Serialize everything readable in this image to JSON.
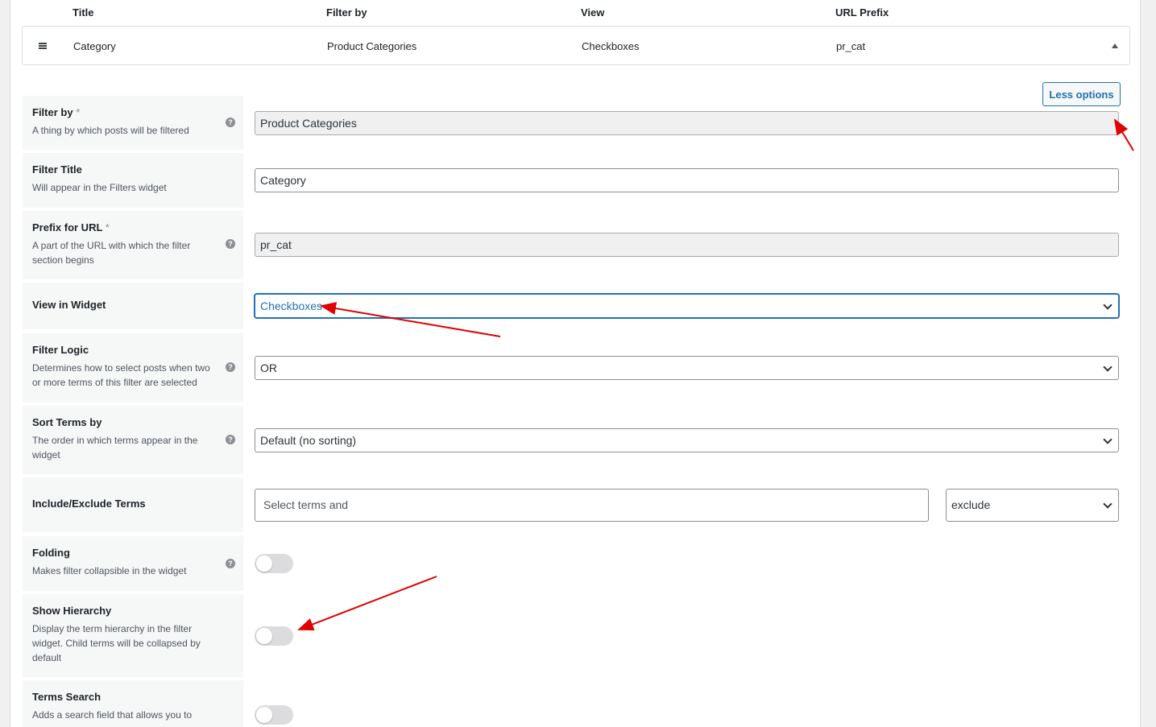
{
  "table": {
    "headers": [
      "Title",
      "Filter by",
      "View",
      "URL Prefix"
    ],
    "row": {
      "title": "Category",
      "filter_by": "Product Categories",
      "view": "Checkboxes",
      "url_prefix": "pr_cat"
    }
  },
  "less_options_label": "Less options",
  "settings": {
    "filter_by": {
      "label": "Filter by",
      "required_mark": "*",
      "desc": "A thing by which posts will be filtered",
      "value": "Product Categories"
    },
    "filter_title": {
      "label": "Filter Title",
      "desc": "Will appear in the Filters widget",
      "value": "Category"
    },
    "prefix": {
      "label": "Prefix for URL",
      "required_mark": "*",
      "desc": "A part of the URL with which the filter section begins",
      "value": "pr_cat"
    },
    "view_in_widget": {
      "label": "View in Widget",
      "value": "Checkboxes"
    },
    "filter_logic": {
      "label": "Filter Logic",
      "desc": "Determines how to select posts when two or more terms of this filter are selected",
      "value": "OR"
    },
    "sort_terms": {
      "label": "Sort Terms by",
      "desc": "The order in which terms appear in the widget",
      "value": "Default (no sorting)"
    },
    "include_exclude": {
      "label": "Include/Exclude Terms",
      "placeholder": "Select terms and",
      "mode": "exclude"
    },
    "folding": {
      "label": "Folding",
      "desc": "Makes filter collapsible in the widget",
      "enabled": false
    },
    "show_hierarchy": {
      "label": "Show Hierarchy",
      "desc": "Display the term hierarchy in the filter widget. Child terms will be collapsed by default",
      "enabled": false
    },
    "terms_search": {
      "label": "Terms Search",
      "desc": "Adds a search field that allows you to",
      "enabled": false
    }
  },
  "help_glyph": "?",
  "colors": {
    "accent": "#2271b1",
    "annotation_arrow": "#e00000"
  }
}
